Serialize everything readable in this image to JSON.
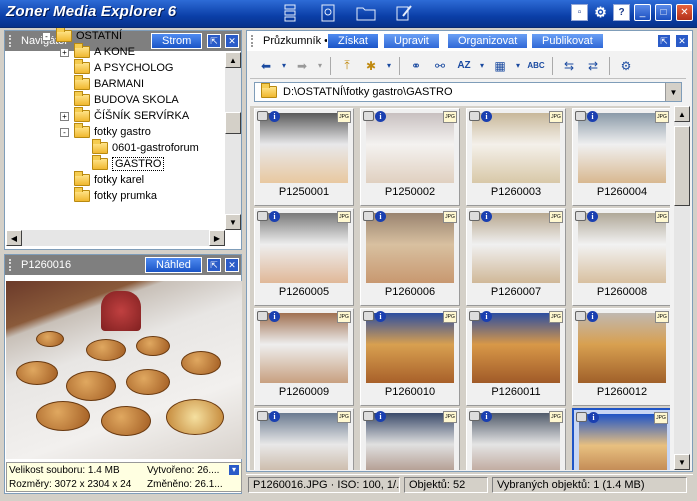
{
  "app": {
    "title": "Zoner Media Explorer 6"
  },
  "navigator": {
    "title": "Navigátor",
    "button": "Strom"
  },
  "tree": [
    {
      "label": "OSTATNÍ",
      "level": 0,
      "expander": "-"
    },
    {
      "label": "A KONE",
      "level": 1,
      "expander": "+"
    },
    {
      "label": "A PSYCHOLOG",
      "level": 1,
      "expander": ""
    },
    {
      "label": "BARMANI",
      "level": 1,
      "expander": ""
    },
    {
      "label": "BUDOVA SKOLA",
      "level": 1,
      "expander": ""
    },
    {
      "label": "ČÍŠNÍK SERVÍRKA",
      "level": 1,
      "expander": "+"
    },
    {
      "label": "fotky gastro",
      "level": 1,
      "expander": "-"
    },
    {
      "label": "0601-gastroforum",
      "level": 2,
      "expander": ""
    },
    {
      "label": "GASTRO",
      "level": 2,
      "expander": "",
      "selected": true
    },
    {
      "label": "fotky karel",
      "level": 1,
      "expander": ""
    },
    {
      "label": "fotky prumka",
      "level": 1,
      "expander": ""
    }
  ],
  "preview": {
    "title": "P1260016",
    "button": "Náhled",
    "size_label": "Velikost souboru: 1.4 MB",
    "created_label": "Vytvořeno: 26....",
    "dims_label": "Rozměry: 3072 x 2304 x 24",
    "modified_label": "Změněno: 26.1..."
  },
  "explorer": {
    "title": "Průzkumník",
    "tabs": [
      "Získat",
      "Upravit",
      "Organizovat",
      "Publikovat"
    ],
    "path": "D:\\OSTATNÍ\\fotky gastro\\GASTRO"
  },
  "thumbs": [
    {
      "name": "P1250001"
    },
    {
      "name": "P1250002"
    },
    {
      "name": "P1260003"
    },
    {
      "name": "P1260004"
    },
    {
      "name": "P1260005"
    },
    {
      "name": "P1260006"
    },
    {
      "name": "P1260007"
    },
    {
      "name": "P1260008"
    },
    {
      "name": "P1260009"
    },
    {
      "name": "P1260010"
    },
    {
      "name": "P1260011"
    },
    {
      "name": "P1260012"
    },
    {
      "name": ""
    },
    {
      "name": ""
    },
    {
      "name": ""
    },
    {
      "name": "",
      "selected": true
    }
  ],
  "thumb_badges": {
    "info": "i",
    "jpg": "JPG"
  },
  "status": {
    "file": "P1260016.JPG · ISO: 100, 1/...",
    "count": "Objektů: 52",
    "selected": "Vybraných objektů: 1 (1.4 MB)"
  },
  "icons": {
    "toolbar": [
      "back-arrow-icon",
      "forward-arrow-icon",
      "folder-up-icon",
      "new-folder-icon",
      "binoculars-icon",
      "binoculars-next-icon",
      "sort-az-icon",
      "view-grid-icon",
      "filename-abc-icon",
      "sync-left-icon",
      "sync-right-icon",
      "gear-filter-icon"
    ]
  }
}
